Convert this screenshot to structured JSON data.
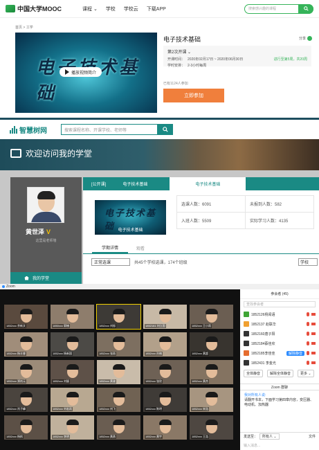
{
  "mooc": {
    "brand": "中国大学MOOC",
    "nav": [
      "课程 ⌄",
      "学校",
      "学校云",
      "下载APP"
    ],
    "search_placeholder": "搜索感兴趣的课程",
    "breadcrumb": "首页 > 工学",
    "cover_title": "电子技术基础",
    "play_label": "播放视频简介",
    "course_name": "电子技术基础",
    "share": "分享",
    "term": "第2次开课 ⌄",
    "dates_label": "开课时间：",
    "dates": "2020年02月17日 ~ 2020年06月30日",
    "status": "进行至第5周，共20周",
    "hours_label": "学时安排：",
    "hours": "2-3小时每周",
    "enrolled": "已有1124人参加",
    "join_button": "立即参加"
  },
  "zhs": {
    "brand": "智慧树网",
    "search_placeholder": "搜索课程名称、开课学校、老师等",
    "banner_title": "欢迎访问我的学堂",
    "teacher_name": "黄世泽",
    "teacher_badge": "V",
    "motto": "这里是老师墙",
    "menu_home": "我的学堂",
    "tab_open": "[公开课]",
    "tab_course": "电子技术基础",
    "tab_active": "电子技术基础",
    "thumb_title": "电子技术基础",
    "thumb_caption": "电子技术基础",
    "stats": {
      "elected": "选课人数：6091",
      "unread": "未报到人数：582",
      "active": "入班人数：5509",
      "studying": "实际学习人数：4135"
    },
    "subtab_detail": "学期详情",
    "subtab_watch": "观看",
    "filter_select": "正常选课",
    "filter_text": "共45个学校选课，174个班级",
    "filter_school": "学校"
  },
  "zoom": {
    "window_title": "Zoom",
    "participants_title": "参会者 (45)",
    "participants_search": "查找参会者",
    "participants": [
      {
        "name": "1852126杨闻语",
        "color": "#3fa535",
        "tag": ""
      },
      {
        "name": "1852137 赵联华",
        "color": "#f0a030",
        "tag": ""
      },
      {
        "name": "1852160唐子阳",
        "color": "#333333",
        "tag": ""
      },
      {
        "name": "1852184蔡佳欣",
        "color": "#333333",
        "tag": ""
      },
      {
        "name": "1852185李佳佳",
        "color": "#e56c2e",
        "tag": "解除静音"
      },
      {
        "name": "1852431 李金光",
        "color": "#333333",
        "tag": ""
      }
    ],
    "mute_all": "全体静音",
    "unmute_all": "解除全体静音",
    "more": "更多 ⌄",
    "chat_title": "Zoom 群聊",
    "chat_from": "我对所有人说:",
    "chat_text": "请翻开书本，下面学习第四章内容，变压器、电动机、加热器",
    "send_to": "发送至：",
    "send_target": "所有人 ⌄",
    "file": "文件",
    "input_placeholder": "输入消息...",
    "tiles": [
      "1852xxx 余新文",
      "1850xxx 郭楠",
      "1852xxx 刘振",
      "1852161 刘立国",
      "1852xxx 王小雨",
      "1852xxx 杨丰睿",
      "1852xxx 杨新国",
      "1852xxx 张雨",
      "1852xxx 孙楠",
      "1852xxx 黄超",
      "1852xxx 郑尚元",
      "1852xxx 刘颖",
      "1852xxx 黄骏",
      "1852xxx 张欣",
      "1852xxx 黄杰",
      "1852xxx 肖子峰",
      "1852xxx 刘若雨",
      "1852xxx 刘飞",
      "1852xxx 陈明",
      "1852xxx 宋浩",
      "1852xxx 杨帆",
      "1852xxx 李明",
      "1852xxx 黄燕",
      "1852xxx 黄宇",
      "1852xxx 王浩"
    ]
  }
}
